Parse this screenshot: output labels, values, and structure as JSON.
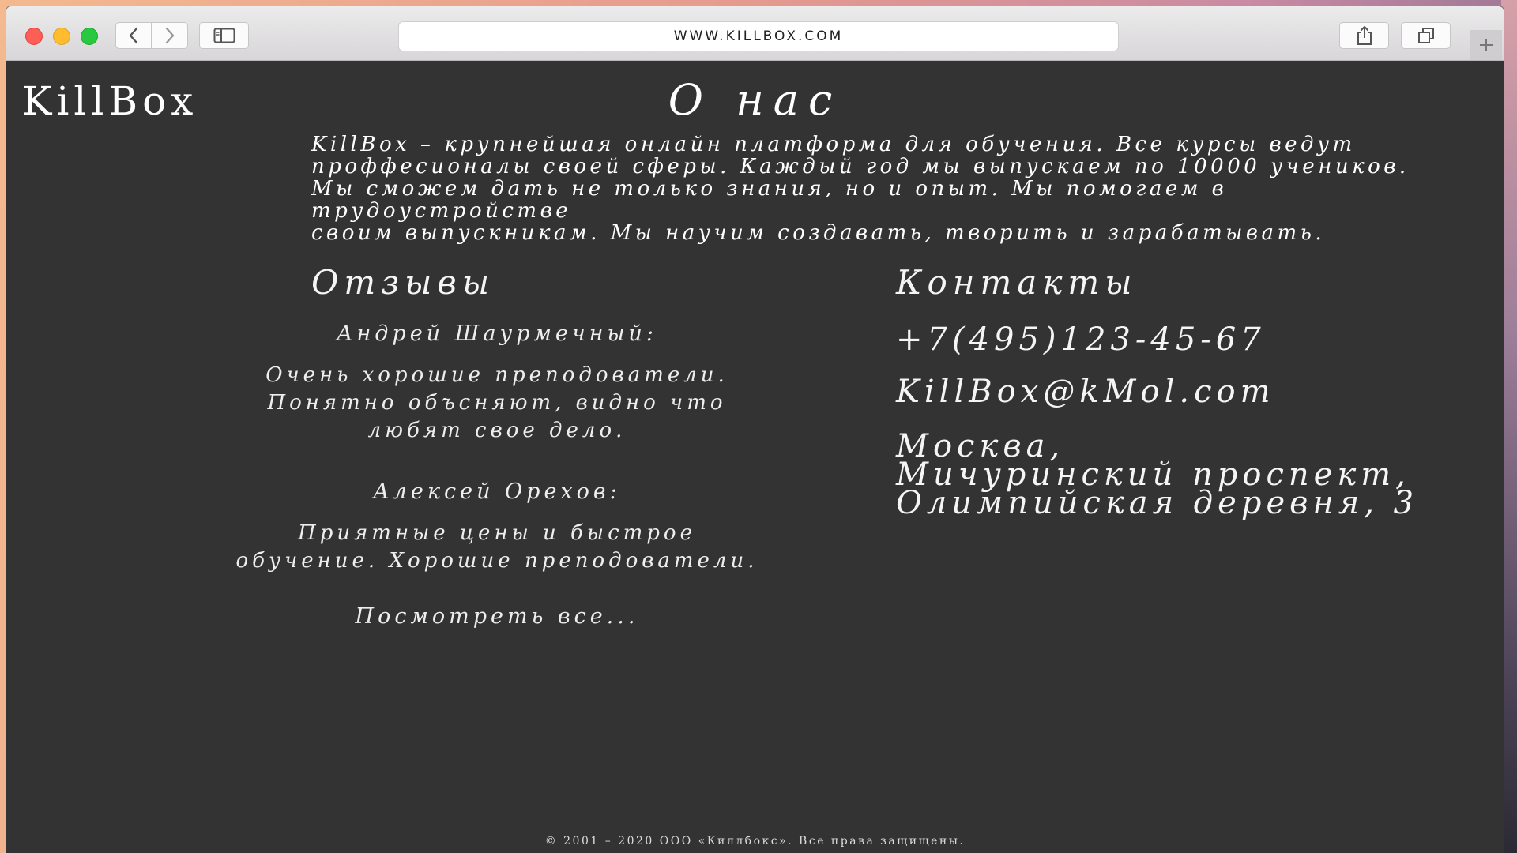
{
  "browser": {
    "url": "WWW.KILLBOX.COM",
    "icons": [
      "back-icon",
      "forward-icon",
      "sidebar-icon",
      "share-icon",
      "tabs-icon",
      "plus-icon"
    ]
  },
  "page": {
    "logo": "KillBox",
    "title": "О нас",
    "about": [
      "KillBox – крупнейшая онлайн платформа для обучения. Все курсы ведут",
      "проффесионалы своей сферы. Каждый год мы выпускаем по 10000 учеников.",
      "Мы сможем дать не только знания, но и опыт. Мы помогаем в трудоустройстве",
      "своим выпускникам. Мы научим создавать, творить и зарабатывать."
    ],
    "reviews": {
      "heading": "Отзывы",
      "items": [
        {
          "author": "Андрей Шаурмечный:",
          "lines": [
            "Очень хорошие преподователи.",
            "Понятно объсняют, видно что",
            "любят свое дело."
          ]
        },
        {
          "author": "Алексей Орехов:",
          "lines": [
            "Приятные цены и быстрое",
            "обучение. Хорошие преподователи."
          ]
        }
      ],
      "view_all": "Посмотреть все..."
    },
    "contacts": {
      "heading": "Контакты",
      "phone": "+7(495)123-45-67",
      "email": "KillBox@kMol.com",
      "address": [
        "Москва,",
        "Мичуринский проспект,",
        "Олимпийская деревня, 3"
      ]
    },
    "footer": "© 2001 – 2020 ООО «Киллбокс». Все права защищены."
  },
  "colors": {
    "page_background": "#333333",
    "text": "#f2f2f2",
    "close": "#fd5f57",
    "minimize": "#febc2e",
    "maximize": "#28c840"
  }
}
